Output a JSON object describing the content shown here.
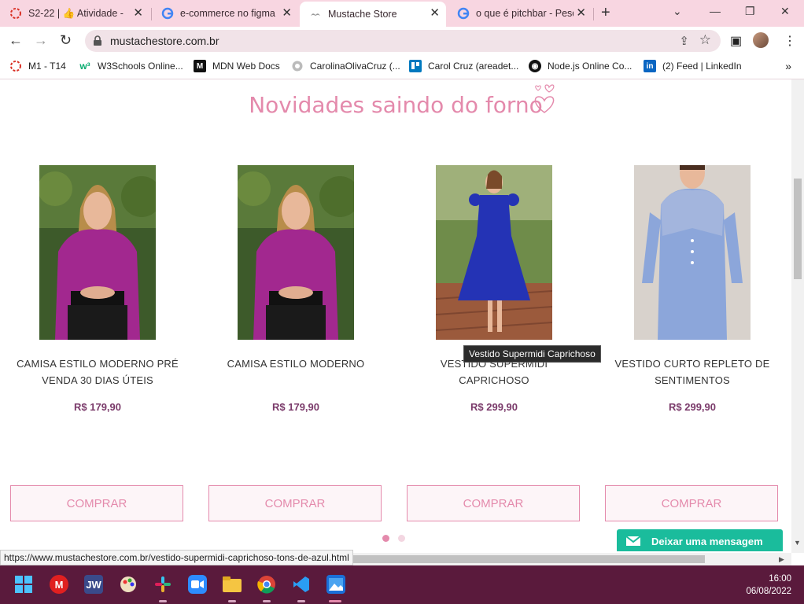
{
  "tabs": [
    {
      "label": "S2-22 | 👍 Atividade -",
      "icon": "recording-icon",
      "active": false
    },
    {
      "label": "e-commerce no figma",
      "icon": "google-icon",
      "active": false
    },
    {
      "label": "Mustache Store",
      "icon": "mustache-icon",
      "active": true
    },
    {
      "label": "o que é pitchbar - Pesq",
      "icon": "google-icon",
      "active": false
    }
  ],
  "toolbar": {
    "url": "mustachestore.com.br"
  },
  "bookmarks": [
    {
      "label": "M1 - T14",
      "icon": "recording-icon",
      "color": "#d93025"
    },
    {
      "label": "W3Schools Online...",
      "icon": "w3schools-icon",
      "color": "#04aa6d"
    },
    {
      "label": "MDN Web Docs",
      "icon": "mdn-icon",
      "color": "#111111"
    },
    {
      "label": "CarolinaOlivaCruz (...",
      "icon": "github-icon",
      "color": "#888888"
    },
    {
      "label": "Carol Cruz (areadet...",
      "icon": "trello-icon",
      "color": "#0079bf"
    },
    {
      "label": "Node.js Online Co...",
      "icon": "replit-icon",
      "color": "#111111"
    },
    {
      "label": "(2) Feed | LinkedIn",
      "icon": "linkedin-icon",
      "color": "#0a66c2"
    }
  ],
  "bookmarks_more": "»",
  "section": {
    "title": "Novidades saindo do forno"
  },
  "products": [
    {
      "name": "CAMISA ESTILO MODERNO PRÉ VENDA 30 DIAS ÚTEIS",
      "price": "R$ 179,90",
      "button": "COMPRAR",
      "image": "woman-magenta-blouse"
    },
    {
      "name": "CAMISA ESTILO MODERNO",
      "price": "R$ 179,90",
      "button": "COMPRAR",
      "image": "woman-magenta-blouse"
    },
    {
      "name": "VESTIDO SUPERMIDI CAPRICHOSO",
      "price": "R$ 299,90",
      "button": "COMPRAR",
      "image": "woman-blue-midi-dress"
    },
    {
      "name": "VESTIDO CURTO REPLETO DE SENTIMENTOS",
      "price": "R$ 299,90",
      "button": "COMPRAR",
      "image": "woman-light-blue-dress"
    }
  ],
  "tooltip": "Vestido Supermidi Caprichoso",
  "carousel": {
    "active_dot": 0,
    "dot_count": 2
  },
  "chat": {
    "label": "Deixar uma mensagem"
  },
  "status_url": "https://www.mustachestore.com.br/vestido-supermidi-caprichoso-tons-de-azul.html",
  "clock": {
    "time": "16:00",
    "date": "06/08/2022"
  },
  "colors": {
    "accent": "#e48aac",
    "price": "#7a3a6a",
    "chat": "#1abc9c",
    "tabbar": "#f8d6e1",
    "taskbar": "#5a1a3c"
  }
}
